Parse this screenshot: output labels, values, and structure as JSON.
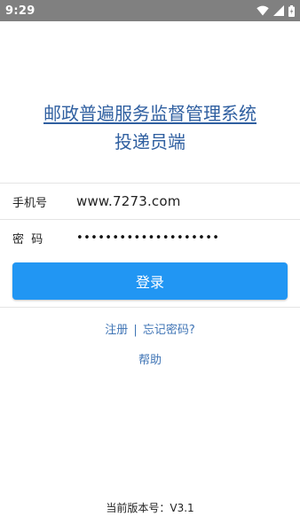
{
  "status_bar": {
    "time": "9:29",
    "icons": [
      "wifi-icon",
      "signal-icon",
      "battery-icon"
    ]
  },
  "header": {
    "title": "邮政普遍服务监督管理系统",
    "subtitle": "投递员端"
  },
  "form": {
    "phone_label": "手机号",
    "phone_value": "www.7273.com",
    "password_label": "密  码",
    "password_value": "••••••••••••••••••••"
  },
  "login_button": {
    "label": "登录"
  },
  "links": {
    "register": "注册",
    "separator": "|",
    "forgot_password": "忘记密码?",
    "help": "帮助"
  },
  "footer": {
    "version_label": "当前版本号：",
    "version_value": "V3.1"
  },
  "colors": {
    "primary": "#2196f3",
    "title": "#2f5fa0",
    "link": "#3f74b5",
    "status_bar": "#808080"
  }
}
